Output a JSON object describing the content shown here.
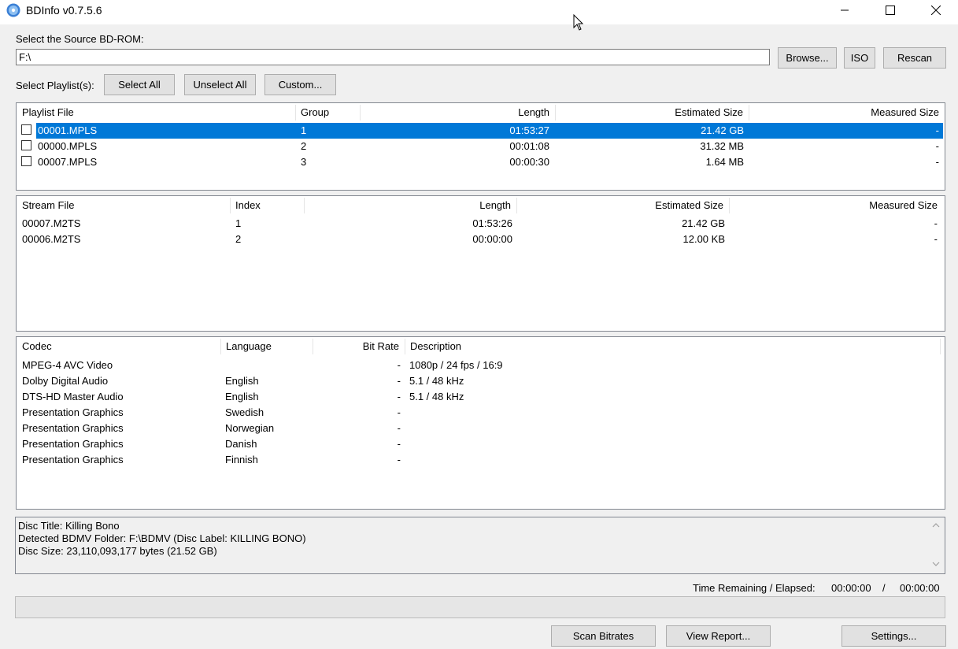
{
  "window": {
    "title": "BDInfo v0.7.5.6"
  },
  "source": {
    "label": "Select the Source BD-ROM:",
    "path": "F:\\",
    "browse": "Browse...",
    "iso": "ISO",
    "rescan": "Rescan"
  },
  "playlist_select": {
    "label": "Select Playlist(s):",
    "select_all": "Select All",
    "unselect_all": "Unselect All",
    "custom": "Custom..."
  },
  "playlists": {
    "headers": [
      "Playlist File",
      "Group",
      "Length",
      "Estimated Size",
      "Measured Size"
    ],
    "rows": [
      {
        "file": "00001.MPLS",
        "group": "1",
        "length": "01:53:27",
        "est": "21.42 GB",
        "measured": "-",
        "selected": true
      },
      {
        "file": "00000.MPLS",
        "group": "2",
        "length": "00:01:08",
        "est": "31.32 MB",
        "measured": "-",
        "selected": false
      },
      {
        "file": "00007.MPLS",
        "group": "3",
        "length": "00:00:30",
        "est": "1.64 MB",
        "measured": "-",
        "selected": false
      }
    ]
  },
  "streams": {
    "headers": [
      "Stream File",
      "Index",
      "Length",
      "Estimated Size",
      "Measured Size"
    ],
    "rows": [
      {
        "file": "00007.M2TS",
        "index": "1",
        "length": "01:53:26",
        "est": "21.42 GB",
        "measured": "-"
      },
      {
        "file": "00006.M2TS",
        "index": "2",
        "length": "00:00:00",
        "est": "12.00 KB",
        "measured": "-"
      }
    ]
  },
  "codecs": {
    "headers": [
      "Codec",
      "Language",
      "Bit Rate",
      "Description"
    ],
    "rows": [
      {
        "codec": "MPEG-4 AVC Video",
        "language": "",
        "bitrate": "-",
        "desc": "1080p / 24 fps / 16:9"
      },
      {
        "codec": "Dolby Digital Audio",
        "language": "English",
        "bitrate": "-",
        "desc": "5.1 / 48 kHz"
      },
      {
        "codec": "DTS-HD Master Audio",
        "language": "English",
        "bitrate": "-",
        "desc": "5.1 / 48 kHz"
      },
      {
        "codec": "Presentation Graphics",
        "language": "Swedish",
        "bitrate": "-",
        "desc": ""
      },
      {
        "codec": "Presentation Graphics",
        "language": "Norwegian",
        "bitrate": "-",
        "desc": ""
      },
      {
        "codec": "Presentation Graphics",
        "language": "Danish",
        "bitrate": "-",
        "desc": ""
      },
      {
        "codec": "Presentation Graphics",
        "language": "Finnish",
        "bitrate": "-",
        "desc": ""
      }
    ]
  },
  "info": {
    "lines": [
      "Disc Title: Killing Bono",
      "Detected BDMV Folder: F:\\BDMV (Disc Label: KILLING BONO)",
      "Disc Size: 23,110,093,177 bytes (21.52 GB)"
    ]
  },
  "status": {
    "time_label": "Time Remaining / Elapsed:",
    "remaining": "00:00:00",
    "separator": "/",
    "elapsed": "00:00:00",
    "progress": 0
  },
  "footer": {
    "scan_bitrates": "Scan Bitrates",
    "view_report": "View Report...",
    "settings": "Settings..."
  },
  "colors": {
    "selection": "#0078d7",
    "window_bg": "#f0f0f0"
  },
  "icons": [
    "disc-icon",
    "minimize-icon",
    "maximize-icon",
    "close-icon",
    "cursor-icon",
    "scroll-up-icon",
    "scroll-down-icon"
  ]
}
